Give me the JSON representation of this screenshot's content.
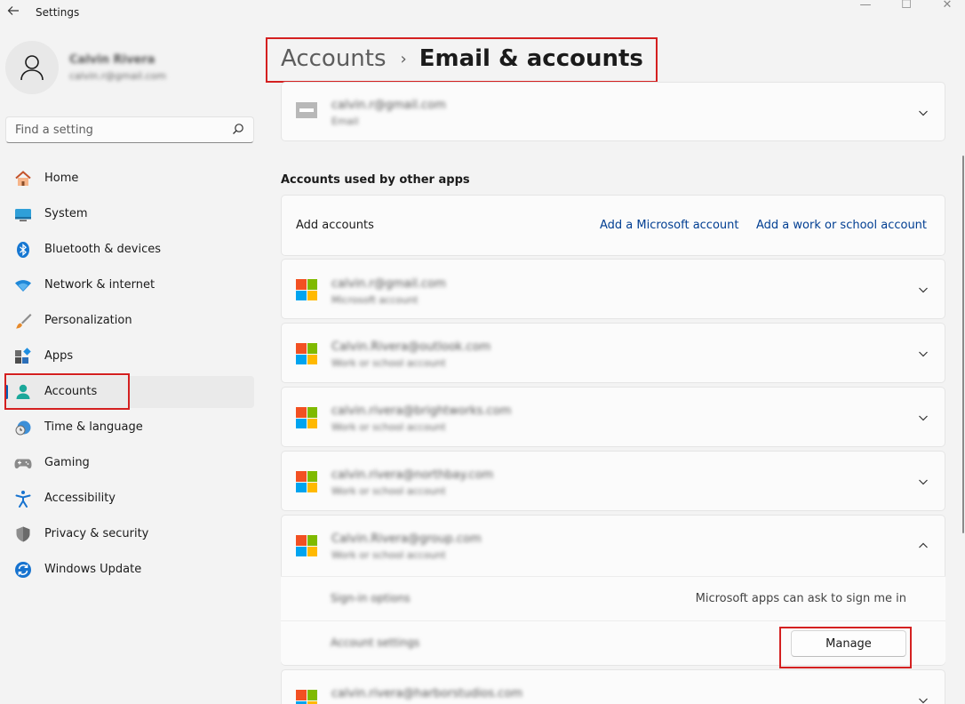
{
  "window": {
    "title": "Settings",
    "controls": {
      "minimize": "—",
      "maximize": "☐",
      "close": "✕"
    }
  },
  "profile": {
    "name": "Calvin Rivera",
    "email": "calvin.r@gmail.com"
  },
  "search": {
    "placeholder": "Find a setting"
  },
  "sidebar": {
    "items": [
      {
        "label": "Home",
        "icon": "home-icon"
      },
      {
        "label": "System",
        "icon": "system-icon"
      },
      {
        "label": "Bluetooth & devices",
        "icon": "bluetooth-icon"
      },
      {
        "label": "Network & internet",
        "icon": "wifi-icon"
      },
      {
        "label": "Personalization",
        "icon": "brush-icon"
      },
      {
        "label": "Apps",
        "icon": "apps-icon"
      },
      {
        "label": "Accounts",
        "icon": "accounts-icon",
        "active": true
      },
      {
        "label": "Time & language",
        "icon": "time-language-icon"
      },
      {
        "label": "Gaming",
        "icon": "gaming-icon"
      },
      {
        "label": "Accessibility",
        "icon": "accessibility-icon"
      },
      {
        "label": "Privacy & security",
        "icon": "shield-icon"
      },
      {
        "label": "Windows Update",
        "icon": "update-icon"
      }
    ]
  },
  "breadcrumb": {
    "parent": "Accounts",
    "separator": "›",
    "current": "Email & accounts"
  },
  "email_account": {
    "address": "calvin.r@gmail.com",
    "type": "Email"
  },
  "other_apps": {
    "section_title": "Accounts used by other apps",
    "add_label": "Add accounts",
    "add_microsoft": "Add a Microsoft account",
    "add_work_school": "Add a work or school account",
    "accounts": [
      {
        "address": "calvin.r@gmail.com",
        "type": "Microsoft account"
      },
      {
        "address": "Calvin.Rivera@outlook.com",
        "type": "Work or school account"
      },
      {
        "address": "calvin.rivera@brightworks.com",
        "type": "Work or school account"
      },
      {
        "address": "calvin.rivera@northbay.com",
        "type": "Work or school account"
      },
      {
        "address": "Calvin.Rivera@group.com",
        "type": "Work or school account"
      },
      {
        "address": "calvin.rivera@harborstudios.com",
        "type": ""
      }
    ],
    "expanded": {
      "signin_label": "Sign-in options",
      "signin_value": "Microsoft apps can ask to sign me in",
      "account_settings_label": "Account settings",
      "manage_label": "Manage"
    }
  },
  "colors": {
    "accent": "#005fb8",
    "link": "#003e92",
    "highlight_box": "#d42020",
    "ms_red": "#f25022",
    "ms_green": "#7fba00",
    "ms_blue": "#00a4ef",
    "ms_yellow": "#ffb900"
  }
}
